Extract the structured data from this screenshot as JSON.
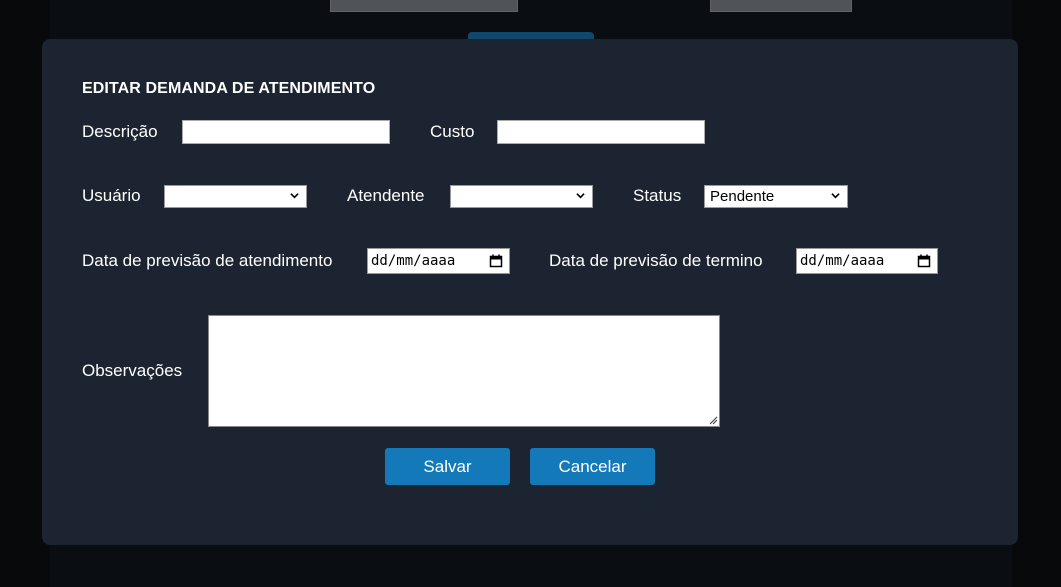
{
  "modal": {
    "title": "EDITAR DEMANDA DE ATENDIMENTO",
    "fields": {
      "descricao_label": "Descrição",
      "descricao_value": "",
      "custo_label": "Custo",
      "custo_value": "",
      "usuario_label": "Usuário",
      "usuario_value": "",
      "atendente_label": "Atendente",
      "atendente_value": "",
      "status_label": "Status",
      "status_value": "Pendente",
      "data_prev_atend_label": "Data de previsão de atendimento",
      "data_prev_atend_placeholder": "dd/mm/aaaa",
      "data_prev_term_label": "Data de previsão de termino",
      "data_prev_term_placeholder": "dd/mm/aaaa",
      "observacoes_label": "Observações",
      "observacoes_value": ""
    },
    "buttons": {
      "save_label": "Salvar",
      "cancel_label": "Cancelar"
    }
  },
  "colors": {
    "modal_bg": "#1b2430",
    "button_bg": "#1479b8",
    "page_bg": "#0b0e12"
  },
  "icons": [
    "chevron-down-icon",
    "calendar-icon",
    "resize-grip-icon"
  ]
}
